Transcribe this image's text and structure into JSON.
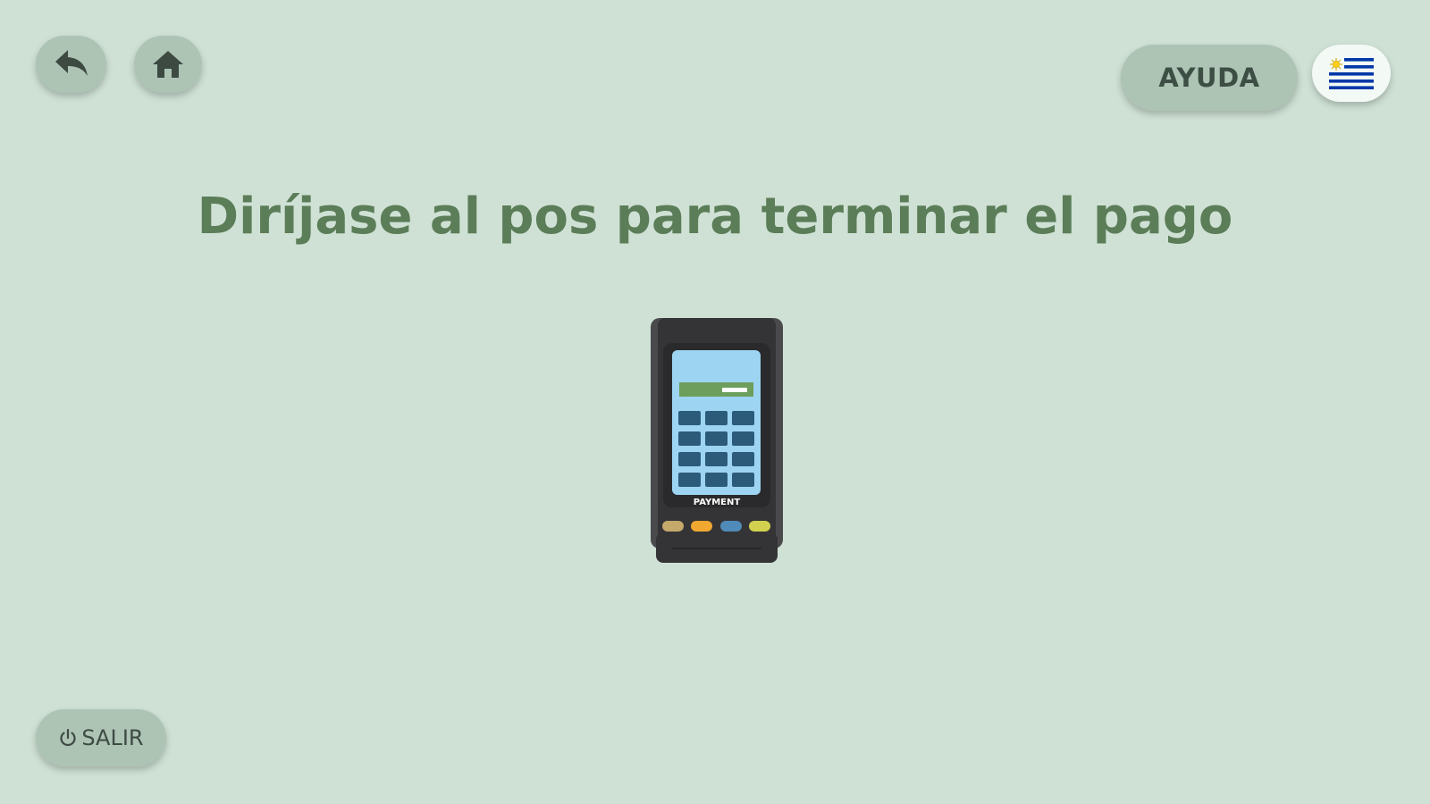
{
  "header": {
    "back_icon": "reply-arrow-icon",
    "home_icon": "home-icon",
    "help_label": "AYUDA",
    "language_flag": "uruguay-flag-icon"
  },
  "main": {
    "title": "Diríjase al pos para terminar el pago",
    "illustration": {
      "icon": "payment-terminal-icon",
      "screen_label": "PAYMENT"
    }
  },
  "footer": {
    "exit_icon": "power-icon",
    "exit_label": "SALIR"
  },
  "colors": {
    "background": "#cfe1d5",
    "button": "#adc4b4",
    "title": "#5b7d58",
    "flag_blue": "#0038a8",
    "flag_sun": "#fcd116"
  }
}
